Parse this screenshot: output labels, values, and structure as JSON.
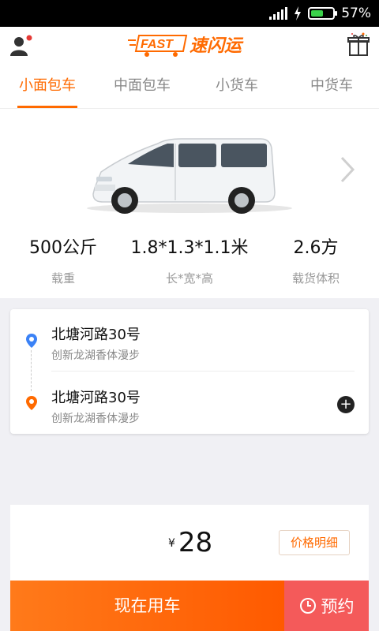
{
  "status_bar": {
    "battery": "57%",
    "battery_level": 0.57
  },
  "tabs": [
    "小面包车",
    "中面包车",
    "小货车",
    "中货车"
  ],
  "active_tab": 0,
  "brand": {
    "fast": "FAST",
    "name": "速闪运"
  },
  "vehicle_specs": [
    {
      "value": "500公斤",
      "label": "载重"
    },
    {
      "value": "1.8*1.3*1.1米",
      "label": "长*宽*高"
    },
    {
      "value": "2.6方",
      "label": "载货体积"
    }
  ],
  "addresses": [
    {
      "title": "北塘河路30号",
      "subtitle": "创新龙湖香体漫步",
      "type": "start"
    },
    {
      "title": "北塘河路30号",
      "subtitle": "创新龙湖香体漫步",
      "type": "end"
    }
  ],
  "price": {
    "currency": "¥",
    "amount": "28",
    "detail_label": "价格明细"
  },
  "actions": {
    "use_now": "现在用车",
    "reserve": "预约"
  },
  "colors": {
    "accent": "#ff6a00",
    "reserve": "#f45a5a",
    "start_dot": "#3b82f6",
    "end_dot": "#ff6a00"
  }
}
